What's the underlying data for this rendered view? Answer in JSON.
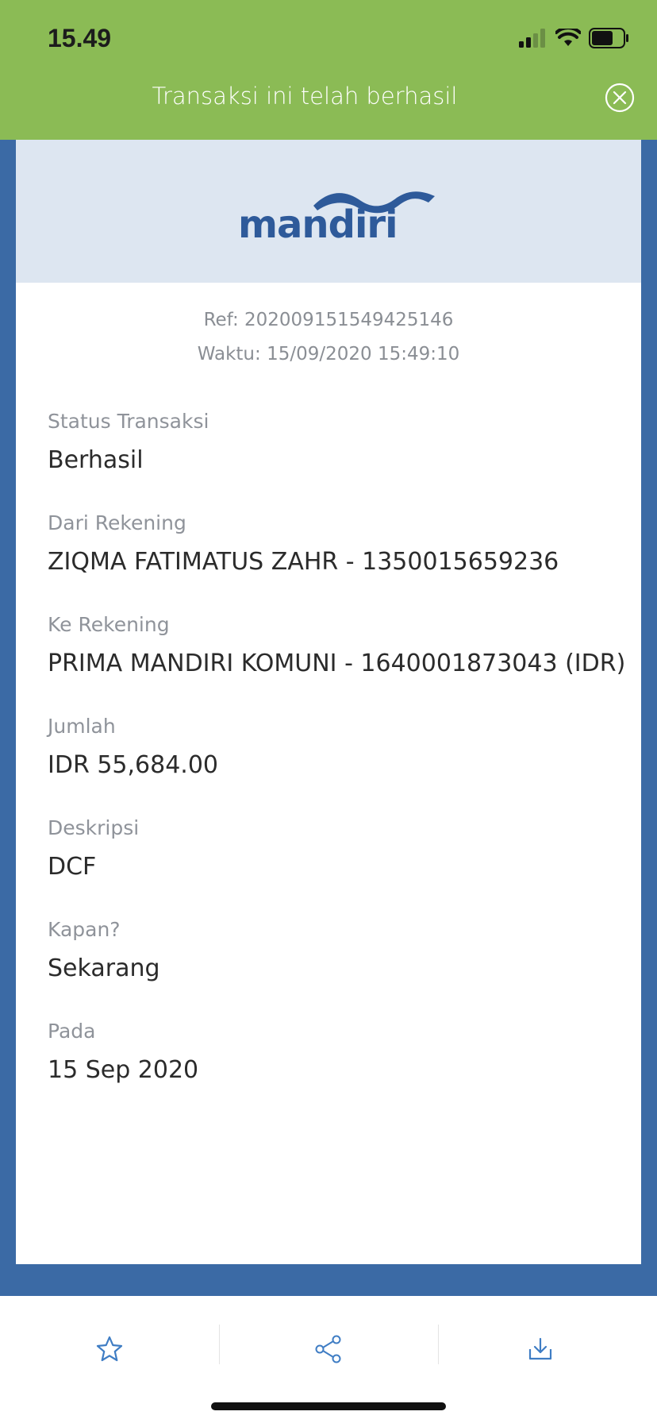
{
  "status_bar": {
    "time": "15.49"
  },
  "header": {
    "title": "Transaksi ini telah berhasil"
  },
  "logo": {
    "text": "mandiri"
  },
  "receipt": {
    "ref": "Ref: 202009151549425146",
    "time": "Waktu: 15/09/2020 15:49:10",
    "fields": [
      {
        "label": "Status Transaksi",
        "value": "Berhasil"
      },
      {
        "label": "Dari Rekening",
        "value": "ZIQMA FATIMATUS ZAHR - 1350015659236"
      },
      {
        "label": "Ke Rekening",
        "value": "PRIMA MANDIRI KOMUNI - 1640001873043 (IDR)"
      },
      {
        "label": "Jumlah",
        "value": "IDR 55,684.00"
      },
      {
        "label": "Deskripsi",
        "value": "DCF"
      },
      {
        "label": "Kapan?",
        "value": "Sekarang"
      },
      {
        "label": "Pada",
        "value": "15 Sep 2020"
      }
    ]
  },
  "toolbar": {
    "icons": [
      "star-icon",
      "share-icon",
      "download-icon"
    ]
  },
  "colors": {
    "header_green": "#8BBB55",
    "background_blue": "#3B6AA5",
    "logo_blue": "#2E5A9A",
    "icon_blue": "#3F7DC4"
  }
}
